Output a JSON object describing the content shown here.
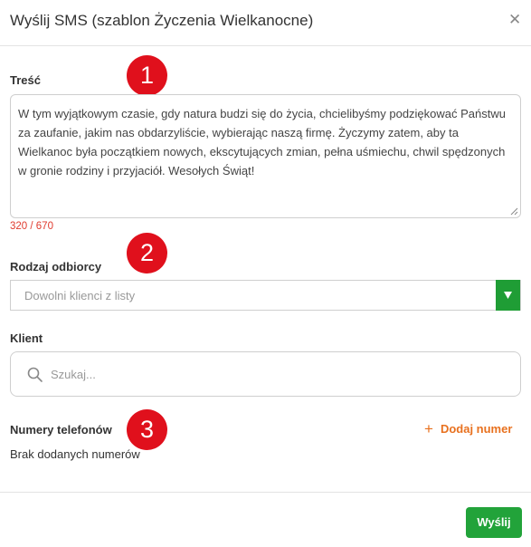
{
  "modal": {
    "title": "Wyślij SMS (szablon Życzenia Wielkanocne)"
  },
  "content": {
    "label": "Treść",
    "text": "W tym wyjątkowym czasie, gdy natura budzi się do życia, chcielibyśmy podziękować Państwu za zaufanie, jakim nas obdarzyliście, wybierając naszą firmę. Życzymy zatem, aby ta Wielkanoc była początkiem nowych, ekscytujących zmian, pełna uśmiechu, chwil spędzonych w gronie rodziny i przyjaciół. Wesołych Świąt!",
    "counter": "320 / 670"
  },
  "recipient_type": {
    "label": "Rodzaj odbiorcy",
    "selected": "Dowolni klienci z listy"
  },
  "client": {
    "label": "Klient",
    "placeholder": "Szukaj..."
  },
  "phones": {
    "label": "Numery telefonów",
    "add_label": "Dodaj numer",
    "empty_text": "Brak dodanych numerów"
  },
  "footer": {
    "send_label": "Wyślij"
  },
  "annotations": {
    "badge_1": "1",
    "badge_2": "2",
    "badge_3": "3"
  },
  "colors": {
    "badge": "#e0101c",
    "accent_green": "#22a33a",
    "accent_orange": "#e8711f",
    "counter_red": "#e03b2e"
  },
  "icons": {
    "close": "close-icon",
    "search": "search-icon",
    "dropdown": "chevron-down-icon",
    "add": "plus-icon"
  }
}
